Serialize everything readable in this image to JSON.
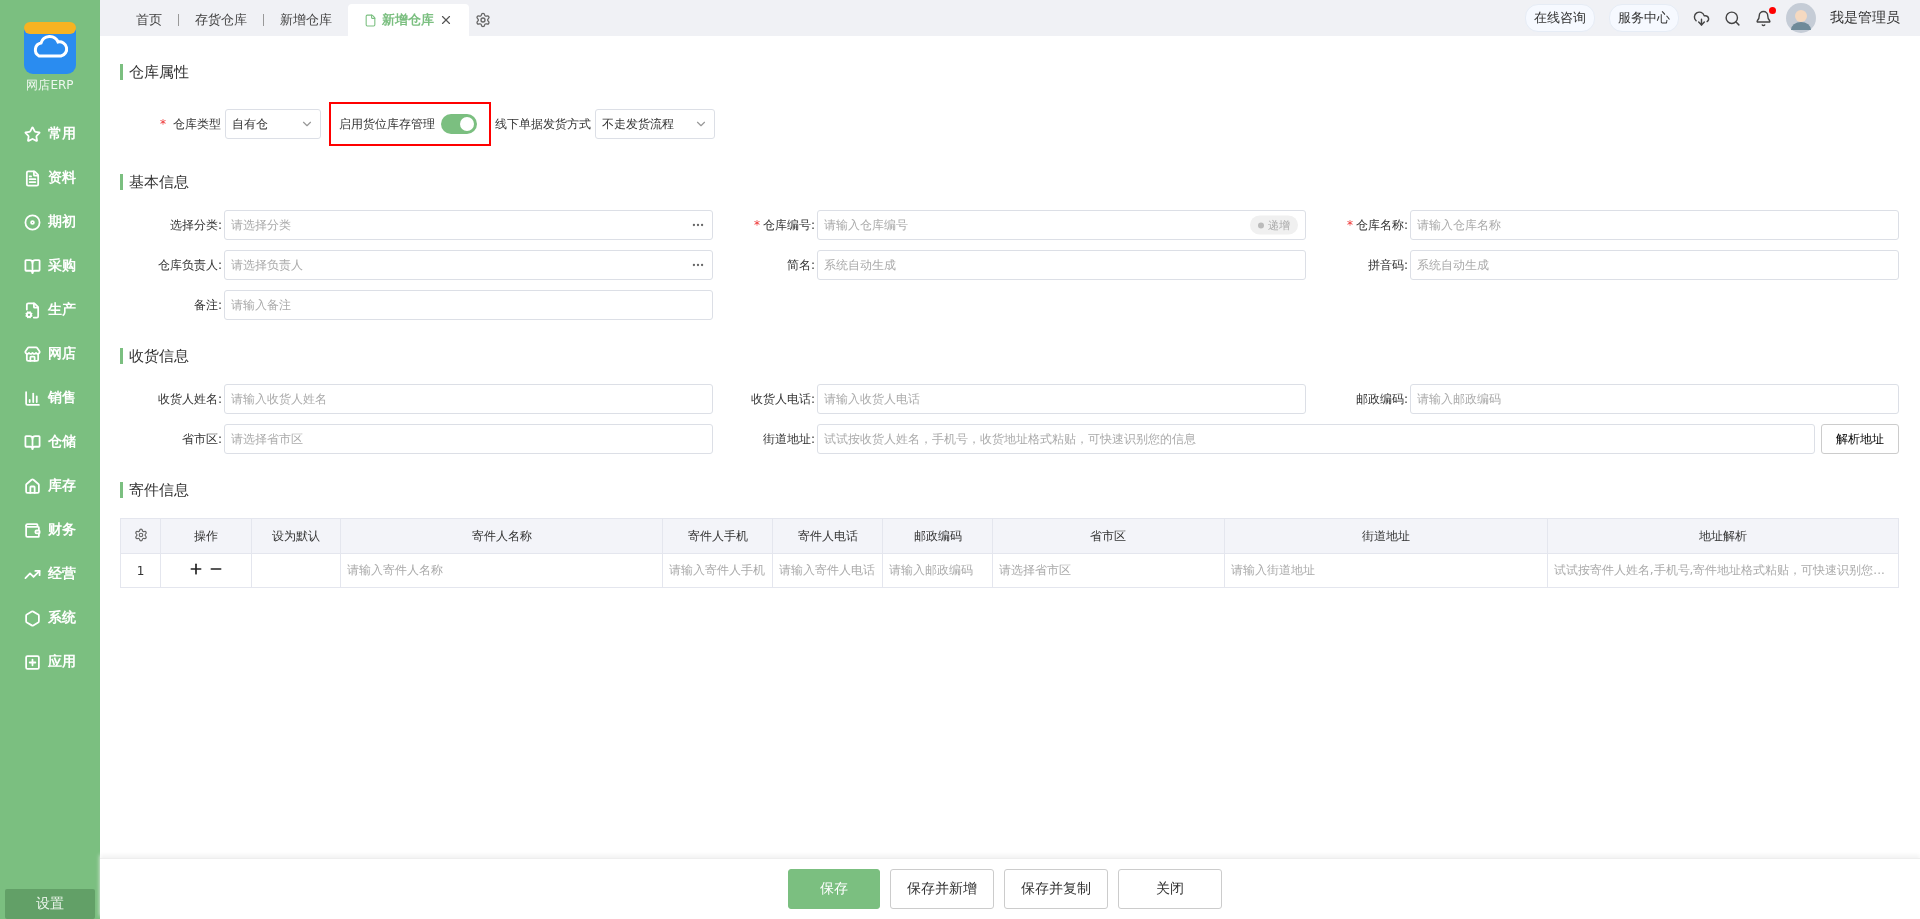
{
  "sidebar": {
    "app_name": "网店ERP",
    "items": [
      {
        "label": "常用"
      },
      {
        "label": "资料"
      },
      {
        "label": "期初"
      },
      {
        "label": "采购"
      },
      {
        "label": "生产"
      },
      {
        "label": "网店"
      },
      {
        "label": "销售"
      },
      {
        "label": "仓储"
      },
      {
        "label": "库存"
      },
      {
        "label": "财务"
      },
      {
        "label": "经营"
      },
      {
        "label": "系统"
      },
      {
        "label": "应用"
      }
    ],
    "settings": "设置"
  },
  "tabs": [
    {
      "label": "首页",
      "selected": false
    },
    {
      "label": "存货仓库",
      "selected": false
    },
    {
      "label": "新增仓库",
      "selected": false
    },
    {
      "label": "新增仓库",
      "selected": true
    }
  ],
  "header": {
    "links": [
      "在线咨询",
      "服务中心"
    ],
    "notification_unread": true,
    "user": "我是管理员"
  },
  "sections": [
    {
      "kind": "inline",
      "title": "仓库属性",
      "fields": [
        {
          "kind": "select",
          "label": "仓库类型",
          "required_mark": "*",
          "value": "自有仓"
        },
        {
          "kind": "toggle",
          "label": "启用货位库存管理",
          "on": true,
          "highlighted": true
        },
        {
          "kind": "select",
          "label": "线下单据发货方式",
          "value": "不走发货流程"
        }
      ]
    },
    {
      "kind": "grid",
      "title": "基本信息",
      "fields": [
        {
          "kind": "picker",
          "label": "选择分类:",
          "placeholder": "请选择分类"
        },
        {
          "kind": "text",
          "label": "仓库编号:",
          "required_mark": "*",
          "placeholder": "请输入仓库编号",
          "tag": "递增"
        },
        {
          "kind": "text",
          "label": "仓库名称:",
          "required_mark": "*",
          "placeholder": "请输入仓库名称"
        },
        {
          "kind": "picker",
          "label": "仓库负责人:",
          "placeholder": "请选择负责人"
        },
        {
          "kind": "text",
          "label": "简名:",
          "placeholder": "系统自动生成"
        },
        {
          "kind": "text",
          "label": "拼音码:",
          "placeholder": "系统自动生成"
        },
        {
          "kind": "text",
          "label": "备注:",
          "placeholder": "请输入备注"
        }
      ]
    },
    {
      "kind": "grid",
      "title": "收货信息",
      "fields": [
        {
          "kind": "text",
          "label": "收货人姓名:",
          "placeholder": "请输入收货人姓名"
        },
        {
          "kind": "text",
          "label": "收货人电话:",
          "placeholder": "请输入收货人电话"
        },
        {
          "kind": "text",
          "label": "邮政编码:",
          "placeholder": "请输入邮政编码"
        },
        {
          "kind": "text",
          "label": "省市区:",
          "placeholder": "请选择省市区"
        },
        {
          "kind": "address",
          "label": "街道地址:",
          "placeholder": "试试按收货人姓名，手机号，收货地址格式粘贴，可快速识别您的信息",
          "button": "解析地址"
        }
      ]
    },
    {
      "kind": "table",
      "title": "寄件信息",
      "columns": [
        "操作",
        "设为默认",
        "寄件人名称",
        "寄件人手机",
        "寄件人电话",
        "邮政编码",
        "省市区",
        "街道地址",
        "地址解析"
      ],
      "rows": [
        {
          "index": "1",
          "cells": [
            "",
            "",
            "请输入寄件人名称",
            "请输入寄件人手机",
            "请输入寄件人电话",
            "请输入邮政编码",
            "请选择省市区",
            "请输入街道地址",
            "试试按寄件人姓名,手机号,寄件地址格式粘贴，可快速识别您..."
          ]
        }
      ]
    }
  ],
  "footer": {
    "buttons": [
      {
        "label": "保存",
        "primary": true
      },
      {
        "label": "保存并新增",
        "primary": false
      },
      {
        "label": "保存并复制",
        "primary": false
      },
      {
        "label": "关闭",
        "primary": false
      }
    ]
  }
}
